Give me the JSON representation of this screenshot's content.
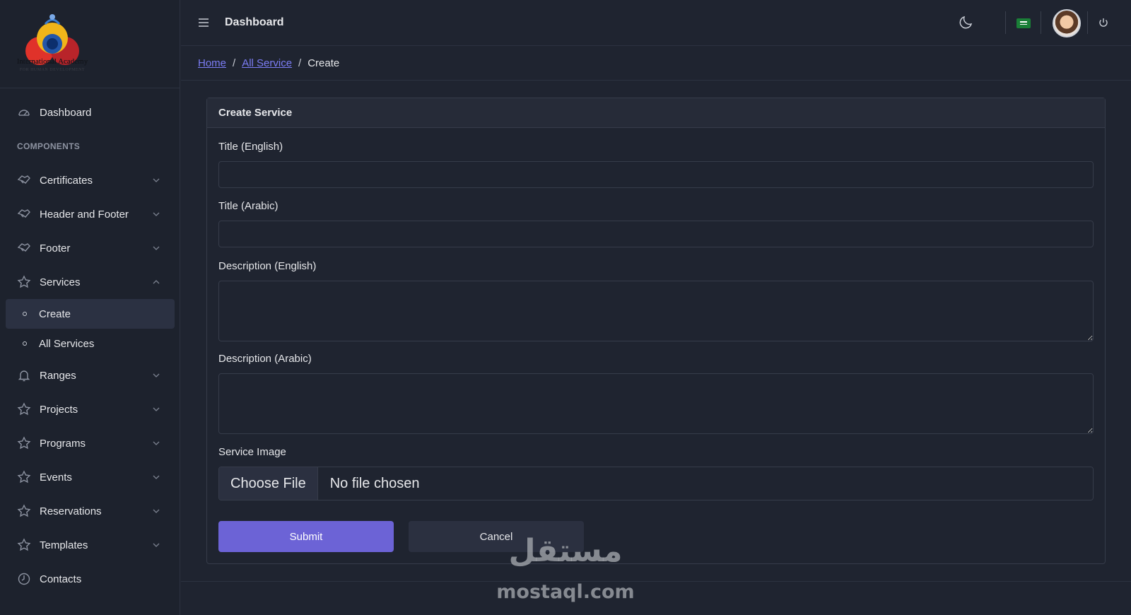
{
  "brand": {
    "logo_text": "International Academy",
    "logo_sub": "FOR HUMAN DEVELOPMENT"
  },
  "sidebar": {
    "dashboard": "Dashboard",
    "section_label": "COMPONENTS",
    "items": [
      {
        "label": "Certificates",
        "icon": "handshake-icon"
      },
      {
        "label": "Header and Footer",
        "icon": "handshake-icon"
      },
      {
        "label": "Footer",
        "icon": "handshake-icon"
      },
      {
        "label": "Services",
        "icon": "star-icon",
        "expanded": true
      },
      {
        "label": "Ranges",
        "icon": "bell-icon"
      },
      {
        "label": "Projects",
        "icon": "star-icon"
      },
      {
        "label": "Programs",
        "icon": "star-icon"
      },
      {
        "label": "Events",
        "icon": "star-icon"
      },
      {
        "label": "Reservations",
        "icon": "star-icon"
      },
      {
        "label": "Templates",
        "icon": "star-icon"
      },
      {
        "label": "Contacts",
        "icon": "clock-icon"
      }
    ],
    "services_sub": {
      "create": "Create",
      "all": "All Services"
    }
  },
  "header": {
    "title": "Dashboard"
  },
  "breadcrumb": {
    "home": "Home",
    "all_service": "All Service",
    "current": "Create",
    "separator": "/"
  },
  "form": {
    "card_title": "Create Service",
    "title_en_label": "Title (English)",
    "title_ar_label": "Title (Arabic)",
    "desc_en_label": "Description (English)",
    "desc_ar_label": "Description (Arabic)",
    "image_label": "Service Image",
    "file_button": "Choose File",
    "file_status": "No file chosen",
    "submit": "Submit",
    "cancel": "Cancel"
  },
  "watermark": {
    "arabic": "مستقل",
    "latin": "mostaql.com"
  },
  "colors": {
    "accent": "#6c63d6",
    "background": "#1f2430",
    "link": "#7c7df5"
  }
}
